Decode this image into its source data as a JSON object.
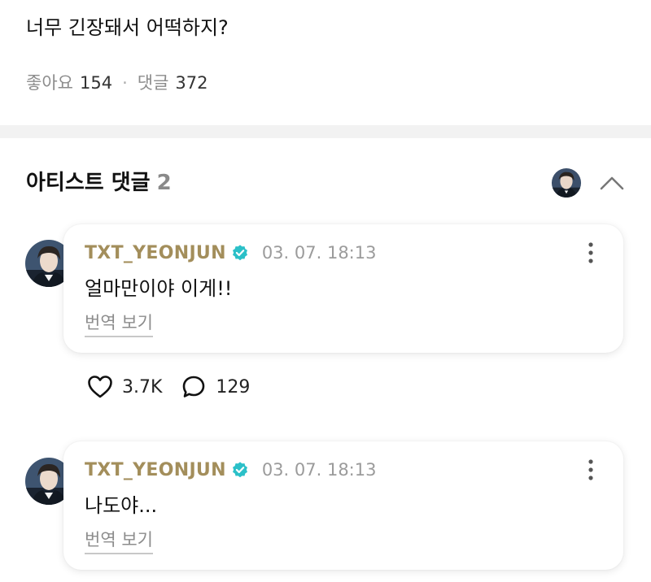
{
  "post": {
    "text": "너무 긴장돼서 어떡하지?",
    "likes_label": "좋아요",
    "likes_count": "154",
    "comments_label": "댓글",
    "comments_count": "372"
  },
  "artist_comments": {
    "title": "아티스트 댓글",
    "count": "2",
    "collapse_icon": "chevron-up-icon"
  },
  "comments": [
    {
      "author": "TXT_YEONJUN",
      "date": "03. 07. 18:13",
      "text": "얼마만이야 이게!!",
      "translate_label": "번역 보기",
      "likes": "3.7K",
      "replies": "129"
    },
    {
      "author": "TXT_YEONJUN",
      "date": "03. 07. 18:13",
      "text": "나도야...",
      "translate_label": "번역 보기"
    }
  ],
  "colors": {
    "author": "#a38e5b",
    "verified_badge": "#2bc0c8",
    "muted": "#8c8c8c"
  }
}
